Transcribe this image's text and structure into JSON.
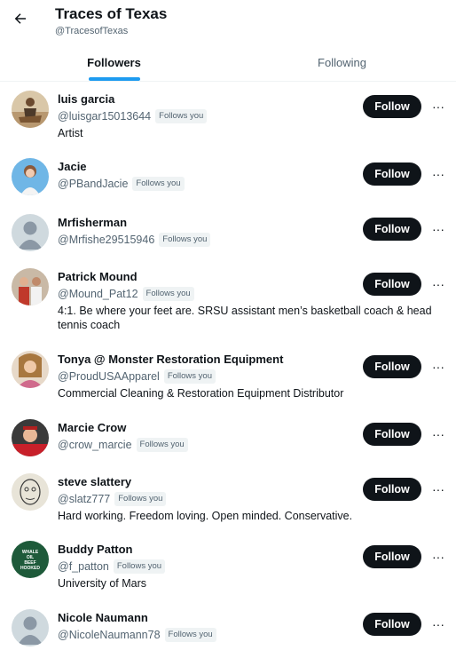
{
  "header": {
    "title": "Traces of Texas",
    "handle": "@TracesofTexas",
    "back_icon": "arrow-left-icon"
  },
  "tabs": [
    {
      "label": "Followers",
      "active": true
    },
    {
      "label": "Following",
      "active": false
    }
  ],
  "users": [
    {
      "name": "luis garcia",
      "handle": "@luisgar15013644",
      "follows_you": "Follows you",
      "bio": "Artist",
      "button": "Follow",
      "more": "···"
    },
    {
      "name": "Jacie",
      "handle": "@PBandJacie",
      "follows_you": "Follows you",
      "bio": "",
      "button": "Follow",
      "more": "···"
    },
    {
      "name": "Mrfisherman",
      "handle": "@Mrfishe29515946",
      "follows_you": "Follows you",
      "bio": "",
      "button": "Follow",
      "more": "···"
    },
    {
      "name": "Patrick Mound",
      "handle": "@Mound_Pat12",
      "follows_you": "Follows you",
      "bio": "4:1. Be where your feet are. SRSU assistant men’s basketball coach & head tennis coach",
      "button": "Follow",
      "more": "···"
    },
    {
      "name": "Tonya @ Monster Restoration Equipment",
      "handle": "@ProudUSAApparel",
      "follows_you": "Follows you",
      "bio": "Commercial Cleaning & Restoration Equipment Distributor",
      "button": "Follow",
      "more": "···"
    },
    {
      "name": "Marcie Crow",
      "handle": "@crow_marcie",
      "follows_you": "Follows you",
      "bio": "",
      "button": "Follow",
      "more": "···"
    },
    {
      "name": "steve slattery",
      "handle": "@slatz777",
      "follows_you": "Follows you",
      "bio": "Hard working. Freedom loving. Open minded. Conservative.",
      "button": "Follow",
      "more": "···"
    },
    {
      "name": "Buddy Patton",
      "handle": "@f_patton",
      "follows_you": "Follows you",
      "bio": "University of Mars",
      "button": "Follow",
      "more": "···",
      "avatar_text": "WHALE OIL BEEF HOOKED"
    },
    {
      "name": "Nicole Naumann",
      "handle": "@NicoleNaumann78",
      "follows_you": "Follows you",
      "bio": "",
      "button": "Follow",
      "more": "···"
    }
  ],
  "colors": {
    "accent": "#1d9bf0",
    "button_bg": "#0f1419",
    "secondary_text": "#536471"
  }
}
